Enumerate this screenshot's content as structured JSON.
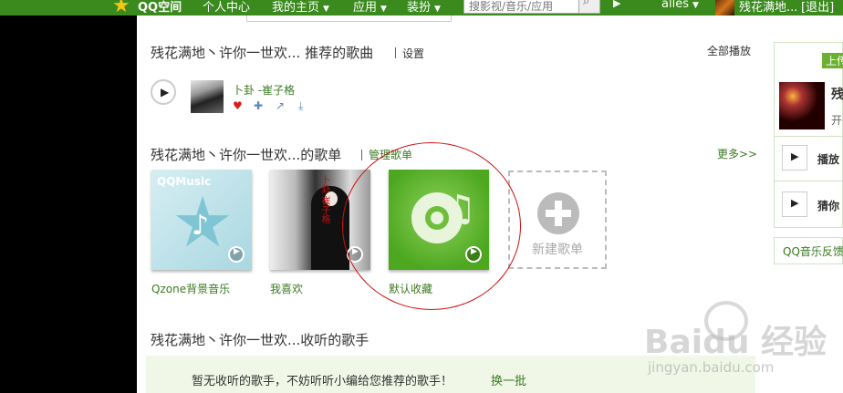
{
  "topbar": {
    "brand": "QQ空间",
    "nav": [
      "个人中心",
      "我的主页",
      "应用",
      "装扮"
    ],
    "search_placeholder": "搜影视/音乐/应用",
    "user": "alles",
    "nick": "残花满地...",
    "logout": "[退出]"
  },
  "recommend": {
    "title": "残花满地丶许你一世欢... 推荐的歌曲",
    "settings": "设置",
    "play_all": "全部播放",
    "song": "卜卦 -崔子格"
  },
  "playlists": {
    "title": "残花满地丶许你一世欢...的歌单",
    "manage": "管理歌单",
    "more": "更多>>",
    "items": [
      {
        "label": "Qzone背景音乐",
        "cover_text": "QQMusic"
      },
      {
        "label": "我喜欢",
        "cover_text": "卜卦 崔子格"
      },
      {
        "label": "默认收藏"
      }
    ],
    "new_label": "新建歌单"
  },
  "singers": {
    "title": "残花满地丶许你一世欢...收听的歌手",
    "empty": "暂无收听的歌手，不妨听听小编给您推荐的歌手！",
    "refresh": "换一批"
  },
  "right_panel": {
    "upload": "上传",
    "name": "残",
    "sub": "开",
    "radio": "播放",
    "guess": "猜你",
    "feedback": "QQ音乐反馈"
  },
  "watermark": {
    "main": "Baidu 经验",
    "sub": "jingyan.baidu.com"
  },
  "colors": {
    "accent": "#3a8a1e",
    "link": "#3a7a1f",
    "annotation": "#cc1111"
  }
}
